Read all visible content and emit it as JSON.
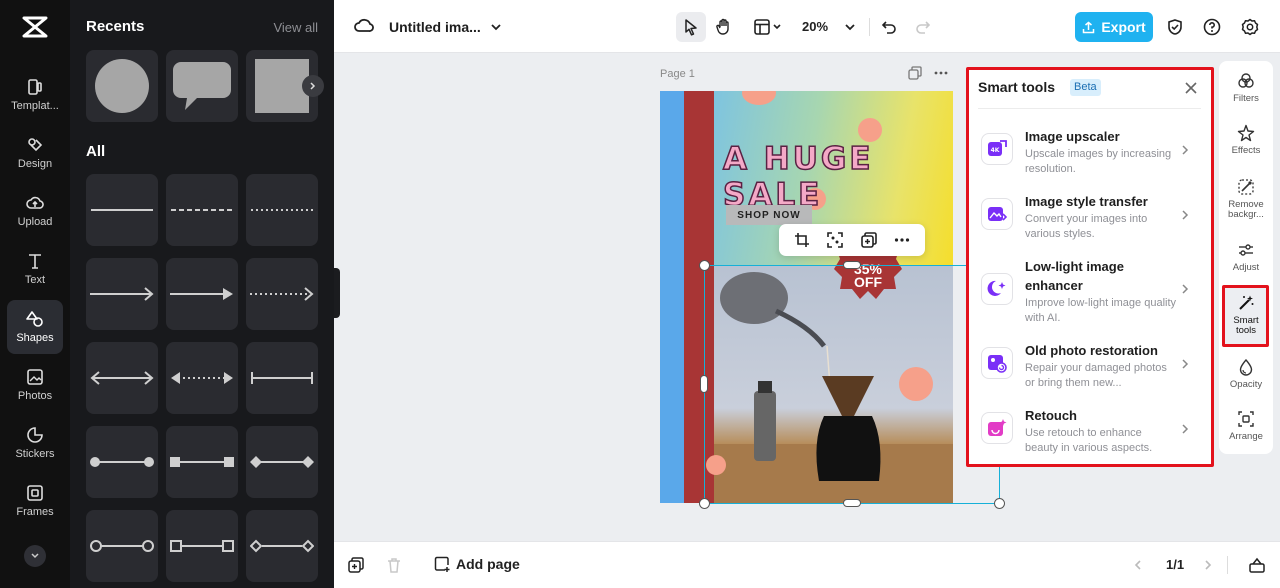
{
  "rail": {
    "items": [
      {
        "label": "Templat..."
      },
      {
        "label": "Design"
      },
      {
        "label": "Upload"
      },
      {
        "label": "Text"
      },
      {
        "label": "Shapes"
      },
      {
        "label": "Photos"
      },
      {
        "label": "Stickers"
      },
      {
        "label": "Frames"
      }
    ],
    "active": "Shapes"
  },
  "panel": {
    "recents_title": "Recents",
    "view_all": "View all",
    "all_title": "All"
  },
  "topbar": {
    "doc_title": "Untitled ima...",
    "zoom": "20%",
    "export_label": "Export",
    "accent": "#1fb2f0"
  },
  "canvas": {
    "page_label": "Page 1",
    "design": {
      "headline": "A HUGE SALE",
      "shop_now": "SHOP NOW",
      "off_line1": "35%",
      "off_line2": "OFF"
    }
  },
  "smart_tools": {
    "title": "Smart tools",
    "badge": "Beta",
    "tools": [
      {
        "name": "Image upscaler",
        "desc": "Upscale images by increasing resolution.",
        "icon": "upscale-4k-icon"
      },
      {
        "name": "Image style transfer",
        "desc": "Convert your images into various styles.",
        "icon": "style-transfer-icon"
      },
      {
        "name": "Low-light image enhancer",
        "desc": "Improve low-light image quality with AI.",
        "icon": "moon-enhance-icon"
      },
      {
        "name": "Old photo restoration",
        "desc": "Repair your damaged photos or bring them new...",
        "icon": "photo-restore-icon"
      },
      {
        "name": "Retouch",
        "desc": "Use retouch to enhance beauty in various aspects.",
        "icon": "retouch-icon"
      }
    ]
  },
  "right_toolbar": {
    "items": [
      {
        "label": "Filters"
      },
      {
        "label": "Effects"
      },
      {
        "label": "Remove backgr..."
      },
      {
        "label": "Adjust"
      },
      {
        "label": "Smart tools"
      },
      {
        "label": "Opacity"
      },
      {
        "label": "Arrange"
      }
    ]
  },
  "bottombar": {
    "add_page": "Add page",
    "pager": "1/1"
  },
  "highlight_color": "#e3121c"
}
